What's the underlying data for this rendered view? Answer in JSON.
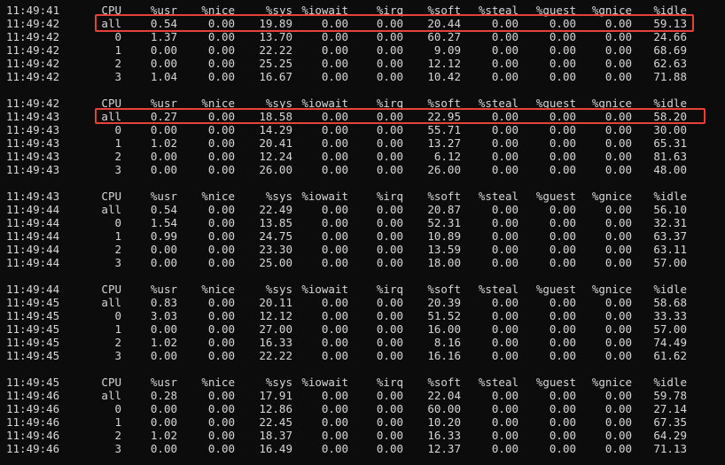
{
  "terminal": {
    "blocks": [
      {
        "header": {
          "time": "11:49:41",
          "cpu": "CPU",
          "usr": "%usr",
          "nice": "%nice",
          "sys": "%sys",
          "iowait": "%iowait",
          "irq": "%irq",
          "soft": "%soft",
          "steal": "%steal",
          "guest": "%guest",
          "gnice": "%gnice",
          "idle": "%idle"
        },
        "rows": [
          {
            "time": "11:49:42",
            "cpu": "all",
            "usr": "0.54",
            "nice": "0.00",
            "sys": "19.89",
            "iowait": "0.00",
            "irq": "0.00",
            "soft": "20.44",
            "steal": "0.00",
            "guest": "0.00",
            "gnice": "0.00",
            "idle": "59.13"
          },
          {
            "time": "11:49:42",
            "cpu": "0",
            "usr": "1.37",
            "nice": "0.00",
            "sys": "13.70",
            "iowait": "0.00",
            "irq": "0.00",
            "soft": "60.27",
            "steal": "0.00",
            "guest": "0.00",
            "gnice": "0.00",
            "idle": "24.66"
          },
          {
            "time": "11:49:42",
            "cpu": "1",
            "usr": "0.00",
            "nice": "0.00",
            "sys": "22.22",
            "iowait": "0.00",
            "irq": "0.00",
            "soft": "9.09",
            "steal": "0.00",
            "guest": "0.00",
            "gnice": "0.00",
            "idle": "68.69"
          },
          {
            "time": "11:49:42",
            "cpu": "2",
            "usr": "0.00",
            "nice": "0.00",
            "sys": "25.25",
            "iowait": "0.00",
            "irq": "0.00",
            "soft": "12.12",
            "steal": "0.00",
            "guest": "0.00",
            "gnice": "0.00",
            "idle": "62.63"
          },
          {
            "time": "11:49:42",
            "cpu": "3",
            "usr": "1.04",
            "nice": "0.00",
            "sys": "16.67",
            "iowait": "0.00",
            "irq": "0.00",
            "soft": "10.42",
            "steal": "0.00",
            "guest": "0.00",
            "gnice": "0.00",
            "idle": "71.88"
          }
        ]
      },
      {
        "header": {
          "time": "11:49:42",
          "cpu": "CPU",
          "usr": "%usr",
          "nice": "%nice",
          "sys": "%sys",
          "iowait": "%iowait",
          "irq": "%irq",
          "soft": "%soft",
          "steal": "%steal",
          "guest": "%guest",
          "gnice": "%gnice",
          "idle": "%idle"
        },
        "rows": [
          {
            "time": "11:49:43",
            "cpu": "all",
            "usr": "0.27",
            "nice": "0.00",
            "sys": "18.58",
            "iowait": "0.00",
            "irq": "0.00",
            "soft": "22.95",
            "steal": "0.00",
            "guest": "0.00",
            "gnice": "0.00",
            "idle": "58.20"
          },
          {
            "time": "11:49:43",
            "cpu": "0",
            "usr": "0.00",
            "nice": "0.00",
            "sys": "14.29",
            "iowait": "0.00",
            "irq": "0.00",
            "soft": "55.71",
            "steal": "0.00",
            "guest": "0.00",
            "gnice": "0.00",
            "idle": "30.00"
          },
          {
            "time": "11:49:43",
            "cpu": "1",
            "usr": "1.02",
            "nice": "0.00",
            "sys": "20.41",
            "iowait": "0.00",
            "irq": "0.00",
            "soft": "13.27",
            "steal": "0.00",
            "guest": "0.00",
            "gnice": "0.00",
            "idle": "65.31"
          },
          {
            "time": "11:49:43",
            "cpu": "2",
            "usr": "0.00",
            "nice": "0.00",
            "sys": "12.24",
            "iowait": "0.00",
            "irq": "0.00",
            "soft": "6.12",
            "steal": "0.00",
            "guest": "0.00",
            "gnice": "0.00",
            "idle": "81.63"
          },
          {
            "time": "11:49:43",
            "cpu": "3",
            "usr": "0.00",
            "nice": "0.00",
            "sys": "26.00",
            "iowait": "0.00",
            "irq": "0.00",
            "soft": "26.00",
            "steal": "0.00",
            "guest": "0.00",
            "gnice": "0.00",
            "idle": "48.00"
          }
        ]
      },
      {
        "header": {
          "time": "11:49:43",
          "cpu": "CPU",
          "usr": "%usr",
          "nice": "%nice",
          "sys": "%sys",
          "iowait": "%iowait",
          "irq": "%irq",
          "soft": "%soft",
          "steal": "%steal",
          "guest": "%guest",
          "gnice": "%gnice",
          "idle": "%idle"
        },
        "rows": [
          {
            "time": "11:49:44",
            "cpu": "all",
            "usr": "0.54",
            "nice": "0.00",
            "sys": "22.49",
            "iowait": "0.00",
            "irq": "0.00",
            "soft": "20.87",
            "steal": "0.00",
            "guest": "0.00",
            "gnice": "0.00",
            "idle": "56.10"
          },
          {
            "time": "11:49:44",
            "cpu": "0",
            "usr": "1.54",
            "nice": "0.00",
            "sys": "13.85",
            "iowait": "0.00",
            "irq": "0.00",
            "soft": "52.31",
            "steal": "0.00",
            "guest": "0.00",
            "gnice": "0.00",
            "idle": "32.31"
          },
          {
            "time": "11:49:44",
            "cpu": "1",
            "usr": "0.99",
            "nice": "0.00",
            "sys": "24.75",
            "iowait": "0.00",
            "irq": "0.00",
            "soft": "10.89",
            "steal": "0.00",
            "guest": "0.00",
            "gnice": "0.00",
            "idle": "63.37"
          },
          {
            "time": "11:49:44",
            "cpu": "2",
            "usr": "0.00",
            "nice": "0.00",
            "sys": "23.30",
            "iowait": "0.00",
            "irq": "0.00",
            "soft": "13.59",
            "steal": "0.00",
            "guest": "0.00",
            "gnice": "0.00",
            "idle": "63.11"
          },
          {
            "time": "11:49:44",
            "cpu": "3",
            "usr": "0.00",
            "nice": "0.00",
            "sys": "25.00",
            "iowait": "0.00",
            "irq": "0.00",
            "soft": "18.00",
            "steal": "0.00",
            "guest": "0.00",
            "gnice": "0.00",
            "idle": "57.00"
          }
        ]
      },
      {
        "header": {
          "time": "11:49:44",
          "cpu": "CPU",
          "usr": "%usr",
          "nice": "%nice",
          "sys": "%sys",
          "iowait": "%iowait",
          "irq": "%irq",
          "soft": "%soft",
          "steal": "%steal",
          "guest": "%guest",
          "gnice": "%gnice",
          "idle": "%idle"
        },
        "rows": [
          {
            "time": "11:49:45",
            "cpu": "all",
            "usr": "0.83",
            "nice": "0.00",
            "sys": "20.11",
            "iowait": "0.00",
            "irq": "0.00",
            "soft": "20.39",
            "steal": "0.00",
            "guest": "0.00",
            "gnice": "0.00",
            "idle": "58.68"
          },
          {
            "time": "11:49:45",
            "cpu": "0",
            "usr": "3.03",
            "nice": "0.00",
            "sys": "12.12",
            "iowait": "0.00",
            "irq": "0.00",
            "soft": "51.52",
            "steal": "0.00",
            "guest": "0.00",
            "gnice": "0.00",
            "idle": "33.33"
          },
          {
            "time": "11:49:45",
            "cpu": "1",
            "usr": "0.00",
            "nice": "0.00",
            "sys": "27.00",
            "iowait": "0.00",
            "irq": "0.00",
            "soft": "16.00",
            "steal": "0.00",
            "guest": "0.00",
            "gnice": "0.00",
            "idle": "57.00"
          },
          {
            "time": "11:49:45",
            "cpu": "2",
            "usr": "1.02",
            "nice": "0.00",
            "sys": "16.33",
            "iowait": "0.00",
            "irq": "0.00",
            "soft": "8.16",
            "steal": "0.00",
            "guest": "0.00",
            "gnice": "0.00",
            "idle": "74.49"
          },
          {
            "time": "11:49:45",
            "cpu": "3",
            "usr": "0.00",
            "nice": "0.00",
            "sys": "22.22",
            "iowait": "0.00",
            "irq": "0.00",
            "soft": "16.16",
            "steal": "0.00",
            "guest": "0.00",
            "gnice": "0.00",
            "idle": "61.62"
          }
        ]
      },
      {
        "header": {
          "time": "11:49:45",
          "cpu": "CPU",
          "usr": "%usr",
          "nice": "%nice",
          "sys": "%sys",
          "iowait": "%iowait",
          "irq": "%irq",
          "soft": "%soft",
          "steal": "%steal",
          "guest": "%guest",
          "gnice": "%gnice",
          "idle": "%idle"
        },
        "rows": [
          {
            "time": "11:49:46",
            "cpu": "all",
            "usr": "0.28",
            "nice": "0.00",
            "sys": "17.91",
            "iowait": "0.00",
            "irq": "0.00",
            "soft": "22.04",
            "steal": "0.00",
            "guest": "0.00",
            "gnice": "0.00",
            "idle": "59.78"
          },
          {
            "time": "11:49:46",
            "cpu": "0",
            "usr": "0.00",
            "nice": "0.00",
            "sys": "12.86",
            "iowait": "0.00",
            "irq": "0.00",
            "soft": "60.00",
            "steal": "0.00",
            "guest": "0.00",
            "gnice": "0.00",
            "idle": "27.14"
          },
          {
            "time": "11:49:46",
            "cpu": "1",
            "usr": "0.00",
            "nice": "0.00",
            "sys": "22.45",
            "iowait": "0.00",
            "irq": "0.00",
            "soft": "10.20",
            "steal": "0.00",
            "guest": "0.00",
            "gnice": "0.00",
            "idle": "67.35"
          },
          {
            "time": "11:49:46",
            "cpu": "2",
            "usr": "1.02",
            "nice": "0.00",
            "sys": "18.37",
            "iowait": "0.00",
            "irq": "0.00",
            "soft": "16.33",
            "steal": "0.00",
            "guest": "0.00",
            "gnice": "0.00",
            "idle": "64.29"
          },
          {
            "time": "11:49:46",
            "cpu": "3",
            "usr": "0.00",
            "nice": "0.00",
            "sys": "16.49",
            "iowait": "0.00",
            "irq": "0.00",
            "soft": "12.37",
            "steal": "0.00",
            "guest": "0.00",
            "gnice": "0.00",
            "idle": "71.13"
          }
        ]
      }
    ]
  },
  "colors": {
    "background": "#0c0c0c",
    "text": "#d7d7d7",
    "highlight": "#e8413a"
  }
}
